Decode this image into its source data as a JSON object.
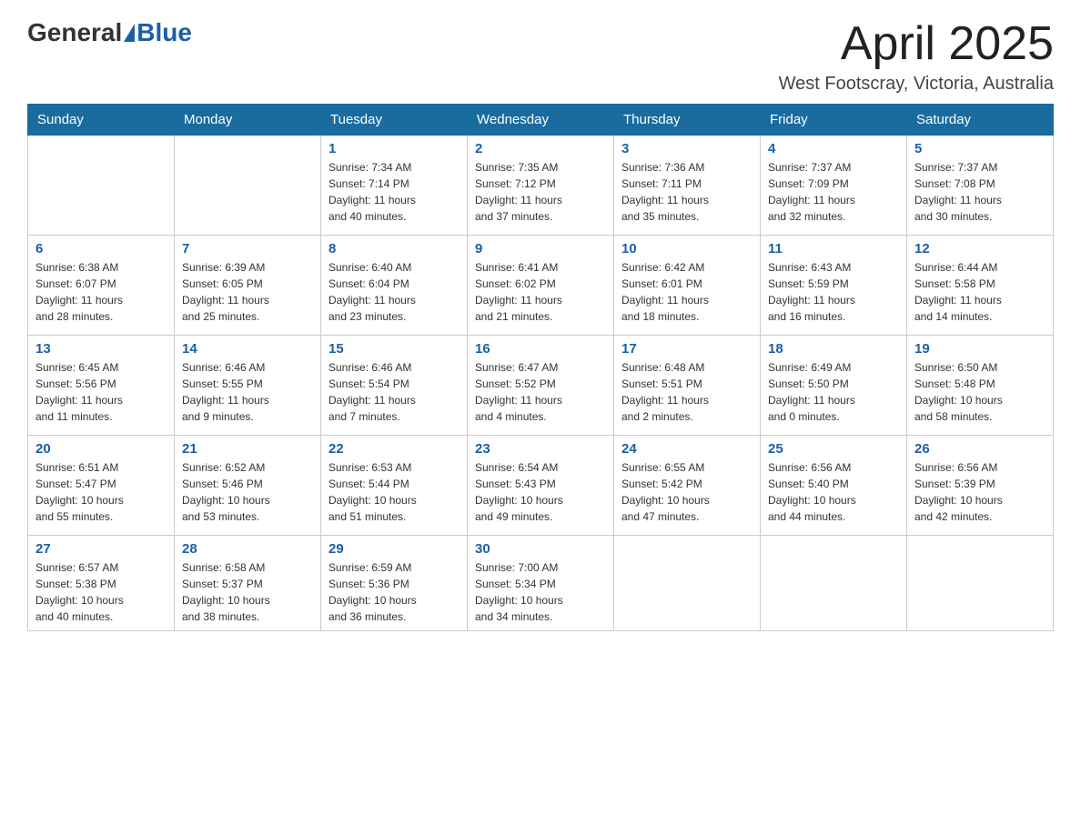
{
  "header": {
    "logo_general": "General",
    "logo_blue": "Blue",
    "month": "April 2025",
    "location": "West Footscray, Victoria, Australia"
  },
  "days_of_week": [
    "Sunday",
    "Monday",
    "Tuesday",
    "Wednesday",
    "Thursday",
    "Friday",
    "Saturday"
  ],
  "weeks": [
    [
      {
        "day": "",
        "info": ""
      },
      {
        "day": "",
        "info": ""
      },
      {
        "day": "1",
        "info": "Sunrise: 7:34 AM\nSunset: 7:14 PM\nDaylight: 11 hours\nand 40 minutes."
      },
      {
        "day": "2",
        "info": "Sunrise: 7:35 AM\nSunset: 7:12 PM\nDaylight: 11 hours\nand 37 minutes."
      },
      {
        "day": "3",
        "info": "Sunrise: 7:36 AM\nSunset: 7:11 PM\nDaylight: 11 hours\nand 35 minutes."
      },
      {
        "day": "4",
        "info": "Sunrise: 7:37 AM\nSunset: 7:09 PM\nDaylight: 11 hours\nand 32 minutes."
      },
      {
        "day": "5",
        "info": "Sunrise: 7:37 AM\nSunset: 7:08 PM\nDaylight: 11 hours\nand 30 minutes."
      }
    ],
    [
      {
        "day": "6",
        "info": "Sunrise: 6:38 AM\nSunset: 6:07 PM\nDaylight: 11 hours\nand 28 minutes."
      },
      {
        "day": "7",
        "info": "Sunrise: 6:39 AM\nSunset: 6:05 PM\nDaylight: 11 hours\nand 25 minutes."
      },
      {
        "day": "8",
        "info": "Sunrise: 6:40 AM\nSunset: 6:04 PM\nDaylight: 11 hours\nand 23 minutes."
      },
      {
        "day": "9",
        "info": "Sunrise: 6:41 AM\nSunset: 6:02 PM\nDaylight: 11 hours\nand 21 minutes."
      },
      {
        "day": "10",
        "info": "Sunrise: 6:42 AM\nSunset: 6:01 PM\nDaylight: 11 hours\nand 18 minutes."
      },
      {
        "day": "11",
        "info": "Sunrise: 6:43 AM\nSunset: 5:59 PM\nDaylight: 11 hours\nand 16 minutes."
      },
      {
        "day": "12",
        "info": "Sunrise: 6:44 AM\nSunset: 5:58 PM\nDaylight: 11 hours\nand 14 minutes."
      }
    ],
    [
      {
        "day": "13",
        "info": "Sunrise: 6:45 AM\nSunset: 5:56 PM\nDaylight: 11 hours\nand 11 minutes."
      },
      {
        "day": "14",
        "info": "Sunrise: 6:46 AM\nSunset: 5:55 PM\nDaylight: 11 hours\nand 9 minutes."
      },
      {
        "day": "15",
        "info": "Sunrise: 6:46 AM\nSunset: 5:54 PM\nDaylight: 11 hours\nand 7 minutes."
      },
      {
        "day": "16",
        "info": "Sunrise: 6:47 AM\nSunset: 5:52 PM\nDaylight: 11 hours\nand 4 minutes."
      },
      {
        "day": "17",
        "info": "Sunrise: 6:48 AM\nSunset: 5:51 PM\nDaylight: 11 hours\nand 2 minutes."
      },
      {
        "day": "18",
        "info": "Sunrise: 6:49 AM\nSunset: 5:50 PM\nDaylight: 11 hours\nand 0 minutes."
      },
      {
        "day": "19",
        "info": "Sunrise: 6:50 AM\nSunset: 5:48 PM\nDaylight: 10 hours\nand 58 minutes."
      }
    ],
    [
      {
        "day": "20",
        "info": "Sunrise: 6:51 AM\nSunset: 5:47 PM\nDaylight: 10 hours\nand 55 minutes."
      },
      {
        "day": "21",
        "info": "Sunrise: 6:52 AM\nSunset: 5:46 PM\nDaylight: 10 hours\nand 53 minutes."
      },
      {
        "day": "22",
        "info": "Sunrise: 6:53 AM\nSunset: 5:44 PM\nDaylight: 10 hours\nand 51 minutes."
      },
      {
        "day": "23",
        "info": "Sunrise: 6:54 AM\nSunset: 5:43 PM\nDaylight: 10 hours\nand 49 minutes."
      },
      {
        "day": "24",
        "info": "Sunrise: 6:55 AM\nSunset: 5:42 PM\nDaylight: 10 hours\nand 47 minutes."
      },
      {
        "day": "25",
        "info": "Sunrise: 6:56 AM\nSunset: 5:40 PM\nDaylight: 10 hours\nand 44 minutes."
      },
      {
        "day": "26",
        "info": "Sunrise: 6:56 AM\nSunset: 5:39 PM\nDaylight: 10 hours\nand 42 minutes."
      }
    ],
    [
      {
        "day": "27",
        "info": "Sunrise: 6:57 AM\nSunset: 5:38 PM\nDaylight: 10 hours\nand 40 minutes."
      },
      {
        "day": "28",
        "info": "Sunrise: 6:58 AM\nSunset: 5:37 PM\nDaylight: 10 hours\nand 38 minutes."
      },
      {
        "day": "29",
        "info": "Sunrise: 6:59 AM\nSunset: 5:36 PM\nDaylight: 10 hours\nand 36 minutes."
      },
      {
        "day": "30",
        "info": "Sunrise: 7:00 AM\nSunset: 5:34 PM\nDaylight: 10 hours\nand 34 minutes."
      },
      {
        "day": "",
        "info": ""
      },
      {
        "day": "",
        "info": ""
      },
      {
        "day": "",
        "info": ""
      }
    ]
  ]
}
